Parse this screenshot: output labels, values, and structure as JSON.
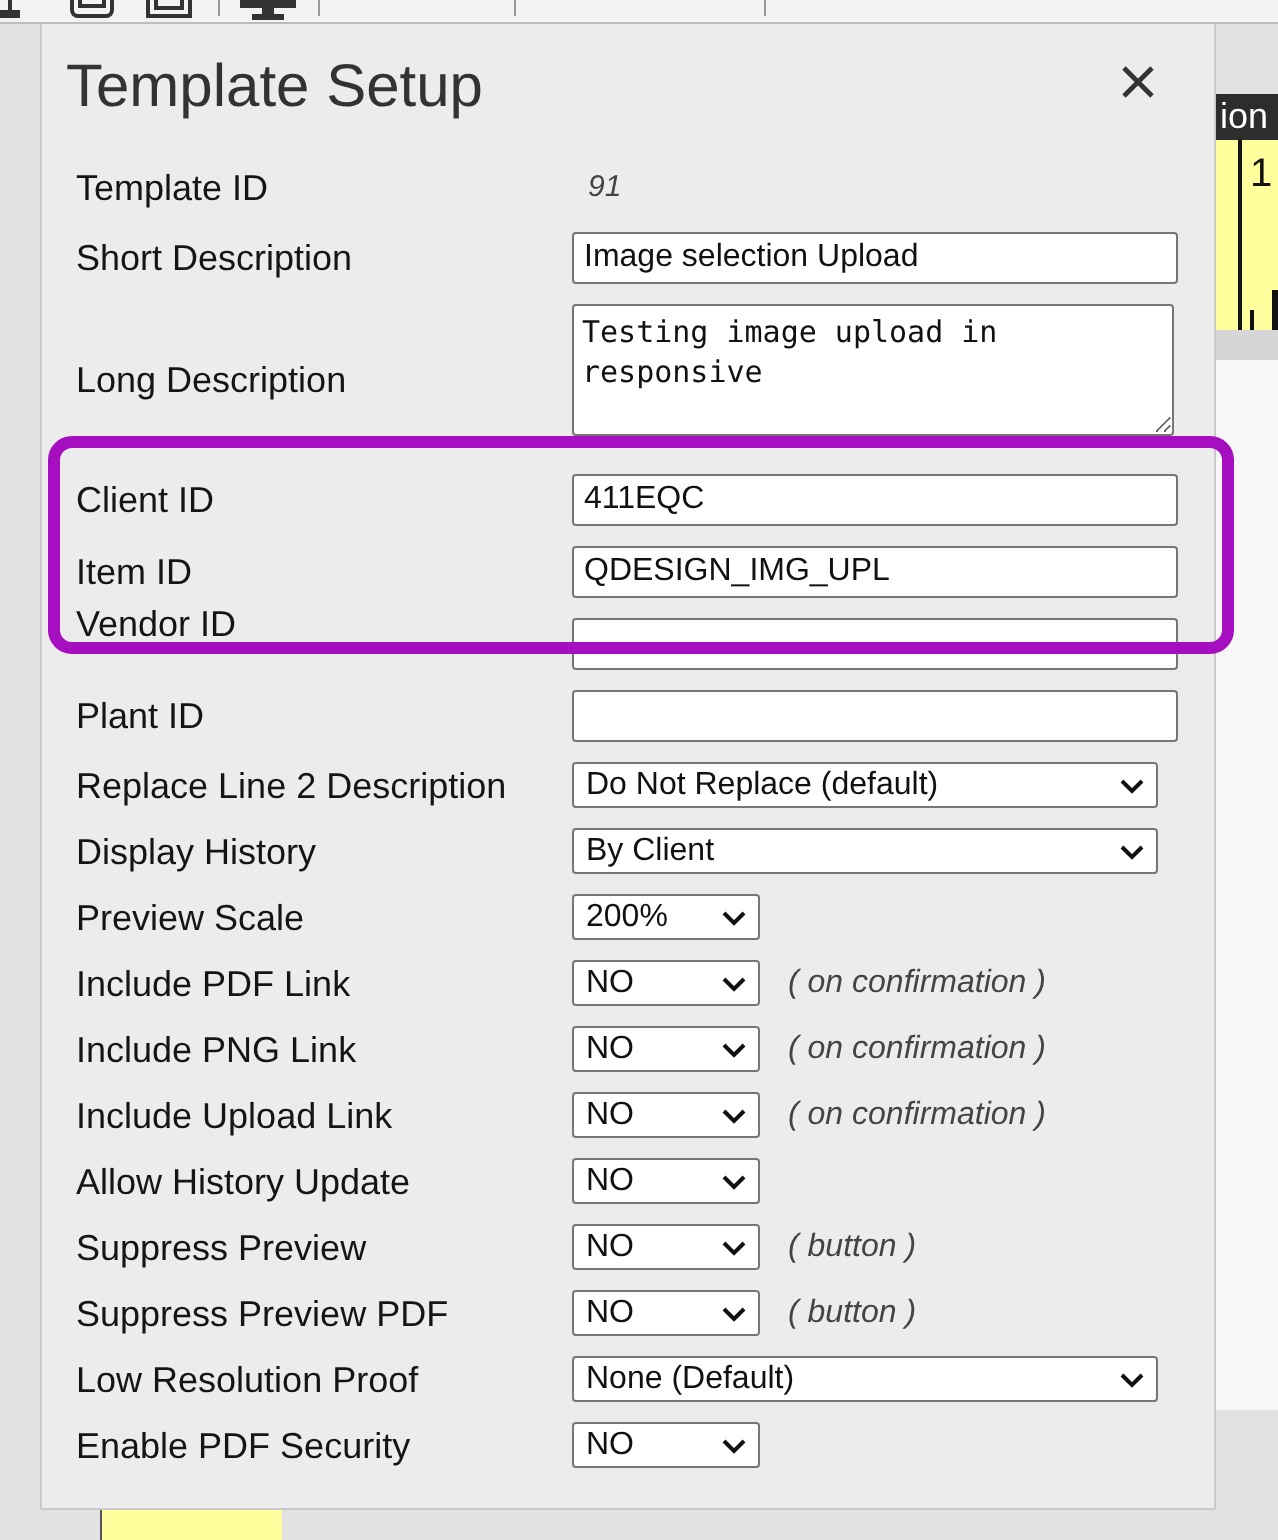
{
  "dialog": {
    "title": "Template Setup",
    "fields": [
      {
        "label": "Template ID",
        "kind": "readonly",
        "value": "91"
      },
      {
        "label": "Short Description",
        "kind": "input",
        "value": "Image selection Upload"
      },
      {
        "label": "Long Description",
        "kind": "textarea",
        "value": "Testing image upload in responsive"
      },
      {
        "label": "Client ID",
        "kind": "input",
        "value": "411EQC"
      },
      {
        "label": "Item ID",
        "kind": "input",
        "value": "QDESIGN_IMG_UPL"
      },
      {
        "label": "Vendor ID",
        "kind": "input"
      },
      {
        "label": "Plant ID",
        "kind": "input"
      },
      {
        "label": "Replace Line 2 Description",
        "kind": "select",
        "value": "Do Not Replace (default)"
      },
      {
        "label": "Display History",
        "kind": "select",
        "value": "By Client"
      },
      {
        "label": "Preview Scale",
        "kind": "narrowselect",
        "value": "200%"
      },
      {
        "label": "Include PDF Link",
        "kind": "narrowselect",
        "value": "NO",
        "note": "( on confirmation )"
      },
      {
        "label": "Include PNG Link",
        "kind": "narrowselect",
        "value": "NO",
        "note": "( on confirmation )"
      },
      {
        "label": "Include Upload Link",
        "kind": "narrowselect",
        "value": "NO",
        "note": "( on confirmation )"
      },
      {
        "label": "Allow History Update",
        "kind": "narrowselect",
        "value": "NO"
      },
      {
        "label": "Suppress Preview",
        "kind": "narrowselect",
        "value": "NO",
        "note": "( button )"
      },
      {
        "label": "Suppress Preview PDF",
        "kind": "narrowselect",
        "value": "NO",
        "note": "( button )"
      },
      {
        "label": "Low Resolution Proof",
        "kind": "select",
        "value": "None (Default)"
      },
      {
        "label": "Enable PDF Security",
        "kind": "narrowselect",
        "value": "NO"
      }
    ]
  },
  "background": {
    "column_header": "ion",
    "column_cell": "1"
  }
}
